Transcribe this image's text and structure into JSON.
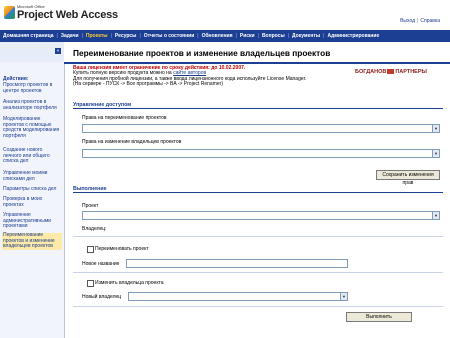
{
  "header": {
    "brand_small": "Microsoft Office",
    "brand": "Project Web Access",
    "links": [
      "Выход",
      "Справка"
    ]
  },
  "nav": {
    "items": [
      "Домашняя страница",
      "Задачи",
      "Проекты",
      "Ресурсы",
      "Отчеты о состоянии",
      "Обновления",
      "Риски",
      "Вопросы",
      "Документы",
      "Администрирование"
    ],
    "active_index": 2
  },
  "sidebar": {
    "title": "Действия:",
    "items": [
      "Просмотр проектов в центре проектов",
      "Анализ проектов в анализаторе портфеля",
      "Моделирование проектов с помощью средств моделирования портфеля",
      "Создание нового личного или общего списка дел",
      "Управление моими списками дел",
      "Параметры списка дел",
      "Проверка в моих проектах",
      "Управление административными проектами",
      "Переименование проектов и изменение владельцев проектов"
    ],
    "active_index": 8
  },
  "page": {
    "title": "Переименование проектов и изменение владельцев проектов",
    "notice_line1": "Ваша лицензия имеет ограничение по сроку действия: до 10.02.2007.",
    "notice_line2_pre": "Купить полную версию продукта можно на ",
    "notice_line2_link": "сайте авторов",
    "notice_line3": "Для получения пробной лицензии, а также ввода лицензионного кода используйте License Manager.",
    "notice_line4": "(На сервере - ПУСК -> Все программы -> BA -> Project Renamer)",
    "partner_logo_left": "БОГДАНОВ",
    "partner_logo_right": "ПАРТНЕРЫ",
    "partner_logo_small": "БАЗ"
  },
  "access": {
    "section_title": "Управление доступом",
    "rename_rights_label": "Права на переименование проектов",
    "owner_rights_label": "Права на изменение владельцев проектов",
    "save_button": "Сохранить изменения прав"
  },
  "execute": {
    "section_title": "Выполнение",
    "project_label": "Проект",
    "owner_label": "Владелец:",
    "rename_checkbox_label": "Переименовать проект",
    "new_name_label": "Новое название",
    "change_owner_checkbox_label": "Изменить владельца проекта",
    "new_owner_label": "Новый владелец",
    "run_button": "Выполнить"
  }
}
